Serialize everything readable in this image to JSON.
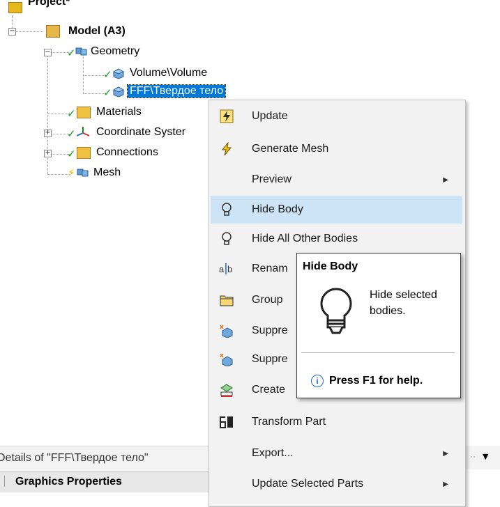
{
  "tree": {
    "project_label": "Project*",
    "model_label": "Model (A3)",
    "geometry_label": "Geometry",
    "volume_label": "Volume\\Volume",
    "fff_label": "FFF\\Твердое тело",
    "materials_label": "Materials",
    "coordinate_label": "Coordinate Syster",
    "connections_label": "Connections",
    "mesh_label": "Mesh"
  },
  "context_menu": {
    "items": [
      {
        "label": "Update",
        "icon": "update-icon"
      },
      {
        "label": "Generate Mesh",
        "icon": "generate-mesh-icon"
      },
      {
        "label": "Preview",
        "icon": "",
        "submenu": true
      },
      {
        "label": "Hide Body",
        "icon": "lightbulb-icon",
        "hover": true
      },
      {
        "label": "Hide All Other Bodies",
        "icon": "lightbulb-icon"
      },
      {
        "label": "Renam",
        "icon": "rename-icon"
      },
      {
        "label": "Group",
        "icon": "folder-icon"
      },
      {
        "label": "Suppre",
        "icon": "suppress-icon"
      },
      {
        "label": "Suppre",
        "icon": "suppress-icon"
      },
      {
        "label": "Create",
        "icon": "create-icon"
      },
      {
        "label": "Transform Part",
        "icon": "transform-part-icon"
      },
      {
        "label": "Export...",
        "icon": "",
        "submenu": true
      },
      {
        "label": "Update Selected Parts",
        "icon": "",
        "submenu": true
      }
    ]
  },
  "tooltip": {
    "title": "Hide Body",
    "description": "Hide selected bodies.",
    "help": "Press F1 for help."
  },
  "details": {
    "header": "Details of \"FFF\\Твердое тело\"",
    "section": "Graphics Properties"
  },
  "colors": {
    "selection": "#0078d7",
    "hover": "#cde3f6",
    "check": "#14a01a"
  }
}
